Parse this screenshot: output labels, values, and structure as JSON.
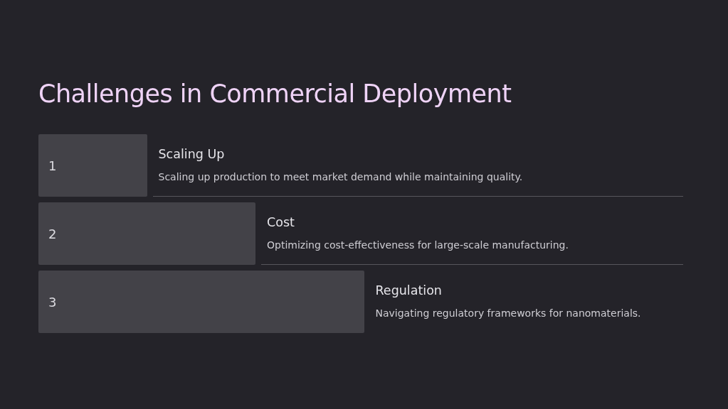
{
  "title": "Challenges in Commercial Deployment",
  "steps": [
    {
      "number": "1",
      "heading": "Scaling Up",
      "text": "Scaling up production to meet market demand while maintaining quality."
    },
    {
      "number": "2",
      "heading": "Cost",
      "text": "Optimizing cost-effectiveness for large-scale manufacturing."
    },
    {
      "number": "3",
      "heading": "Regulation",
      "text": "Navigating regulatory frameworks for nanomaterials."
    }
  ]
}
